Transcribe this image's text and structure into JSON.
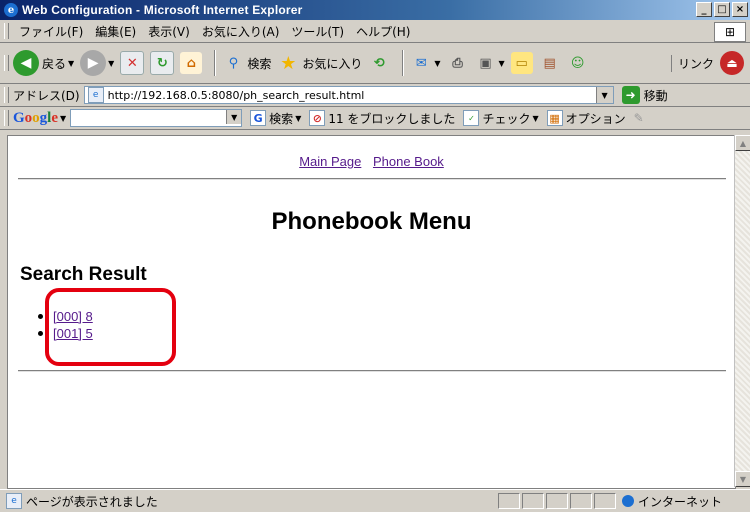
{
  "window": {
    "title": "Web Configuration - Microsoft Internet Explorer",
    "buttons": [
      "_",
      "□",
      "×"
    ]
  },
  "menubar": {
    "items": [
      "ファイル(F)",
      "編集(E)",
      "表示(V)",
      "お気に入り(A)",
      "ツール(T)",
      "ヘルプ(H)"
    ]
  },
  "toolbar": {
    "back_label": "戻る",
    "search_label": "検索",
    "favorites_label": "お気に入り",
    "links_label": "リンク"
  },
  "address": {
    "label": "アドレス(D)",
    "url": "http://192.168.0.5:8080/ph_search_result.html",
    "go_label": "移動"
  },
  "google_toolbar": {
    "search_label": "検索",
    "blocked_label": "11 をブロックしました",
    "check_label": "チェック",
    "options_label": "オプション"
  },
  "page": {
    "nav_links": [
      "Main Page",
      "Phone Book"
    ],
    "heading": "Phonebook Menu",
    "subheading": "Search Result",
    "results": [
      "[000] 8",
      "[001] 5"
    ]
  },
  "statusbar": {
    "text": "ページが表示されました",
    "zone": "インターネット"
  },
  "colors": {
    "highlight_border": "#e4000f",
    "visited_link": "#551a8b"
  }
}
